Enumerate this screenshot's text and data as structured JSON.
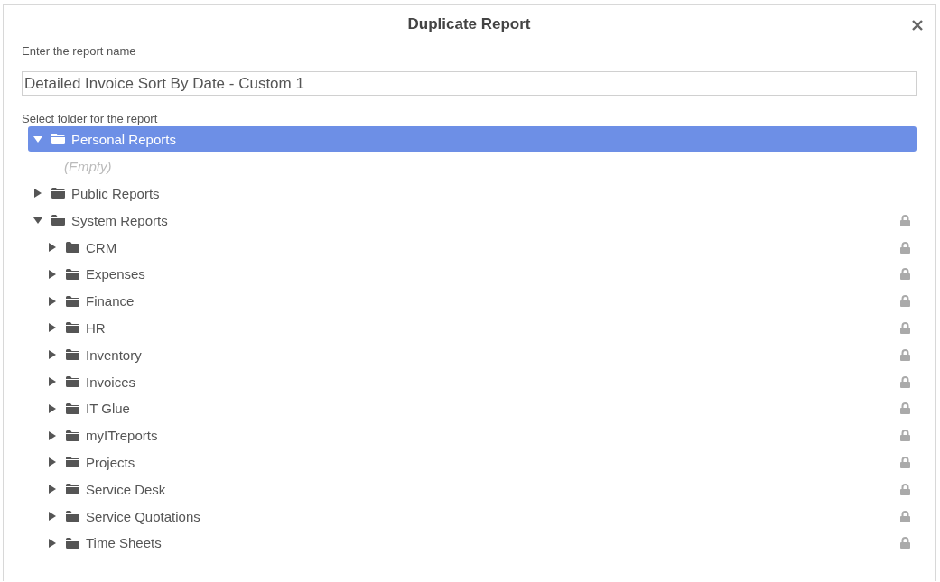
{
  "dialog": {
    "title": "Duplicate Report"
  },
  "name_field": {
    "label": "Enter the report name",
    "value": "Detailed Invoice Sort By Date - Custom 1"
  },
  "folder_label": "Select folder for the report",
  "folders": [
    {
      "kind": "folder",
      "label": "Personal Reports",
      "selected": true,
      "expanded": true,
      "locked": false,
      "children": [
        {
          "kind": "empty",
          "label": "(Empty)"
        }
      ]
    },
    {
      "kind": "folder",
      "label": "Public Reports",
      "selected": false,
      "expanded": false,
      "locked": false
    },
    {
      "kind": "folder",
      "label": "System Reports",
      "selected": false,
      "expanded": true,
      "locked": true,
      "children": [
        {
          "kind": "folder",
          "label": "CRM",
          "selected": false,
          "expanded": false,
          "locked": true
        },
        {
          "kind": "folder",
          "label": "Expenses",
          "selected": false,
          "expanded": false,
          "locked": true
        },
        {
          "kind": "folder",
          "label": "Finance",
          "selected": false,
          "expanded": false,
          "locked": true
        },
        {
          "kind": "folder",
          "label": "HR",
          "selected": false,
          "expanded": false,
          "locked": true
        },
        {
          "kind": "folder",
          "label": "Inventory",
          "selected": false,
          "expanded": false,
          "locked": true
        },
        {
          "kind": "folder",
          "label": "Invoices",
          "selected": false,
          "expanded": false,
          "locked": true
        },
        {
          "kind": "folder",
          "label": "IT Glue",
          "selected": false,
          "expanded": false,
          "locked": true
        },
        {
          "kind": "folder",
          "label": "myITreports",
          "selected": false,
          "expanded": false,
          "locked": true
        },
        {
          "kind": "folder",
          "label": "Projects",
          "selected": false,
          "expanded": false,
          "locked": true
        },
        {
          "kind": "folder",
          "label": "Service Desk",
          "selected": false,
          "expanded": false,
          "locked": true
        },
        {
          "kind": "folder",
          "label": "Service Quotations",
          "selected": false,
          "expanded": false,
          "locked": true
        },
        {
          "kind": "folder",
          "label": "Time Sheets",
          "selected": false,
          "expanded": false,
          "locked": true
        }
      ]
    }
  ]
}
